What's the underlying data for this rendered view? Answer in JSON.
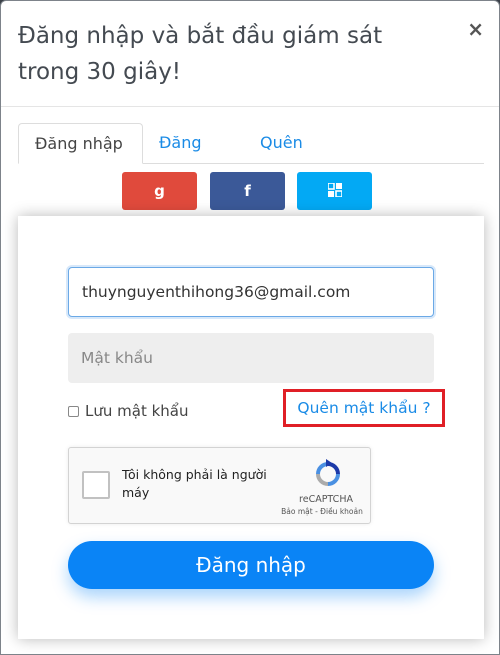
{
  "modal": {
    "title": "Đăng nhập và bắt đầu giám sát trong 30 giây!",
    "close_label": "×"
  },
  "tabs": [
    {
      "label": "Đăng nhập",
      "active": true
    },
    {
      "label": "Đăng ký",
      "active": false
    },
    {
      "label": "Quên MK",
      "active": false
    }
  ],
  "social": {
    "google_label": "g",
    "facebook_label": "f",
    "microsoft_icon": "windows-icon",
    "google_color": "#e04a3c",
    "facebook_color": "#3b5998",
    "microsoft_color": "#03a9f4"
  },
  "form": {
    "email_value": "thuynguyenthihong36@gmail.com",
    "password_placeholder": "Mật khẩu",
    "remember_label": "Lưu mật khẩu",
    "forgot_label": "Quên mật khẩu ?",
    "captcha_label": "Tôi không phải là người máy",
    "captcha_brand": "reCAPTCHA",
    "captcha_terms": "Bảo mật - Điều khoản",
    "submit_label": "Đăng nhập"
  },
  "colors": {
    "accent": "#0a84f6",
    "link": "#1a8be6",
    "highlight_border": "#e01f26"
  }
}
